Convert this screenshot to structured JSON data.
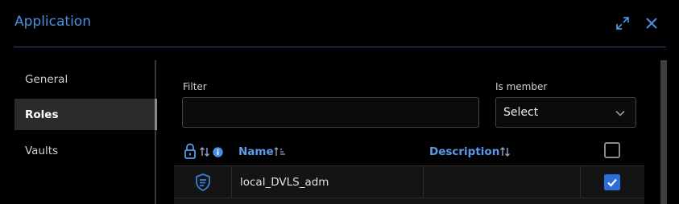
{
  "dialog": {
    "title": "Application",
    "icons": {
      "expand": "expand-icon",
      "close": "close-icon"
    }
  },
  "colors": {
    "accent": "#4a90e2",
    "background": "#000000",
    "checkbox_checked": "#2a6fd8"
  },
  "sidebar": {
    "items": [
      {
        "label": "General",
        "active": false
      },
      {
        "label": "Roles",
        "active": true
      },
      {
        "label": "Vaults",
        "active": false
      }
    ]
  },
  "filter": {
    "label": "Filter",
    "value": "",
    "placeholder": ""
  },
  "is_member": {
    "label": "Is member",
    "selected": "Select"
  },
  "table": {
    "columns": [
      {
        "label": "",
        "icon": "lock-icon",
        "extra_icons": [
          "sort-icon",
          "info-icon"
        ]
      },
      {
        "label": "Name",
        "icon": "sort-asc-icon"
      },
      {
        "label": "Description",
        "icon": "sort-icon"
      },
      {
        "label": "",
        "icon": "checkbox",
        "checked": false
      }
    ],
    "rows": [
      {
        "icon": "shield-icon",
        "name": "local_DVLS_adm",
        "description": "",
        "checked": true
      }
    ]
  }
}
